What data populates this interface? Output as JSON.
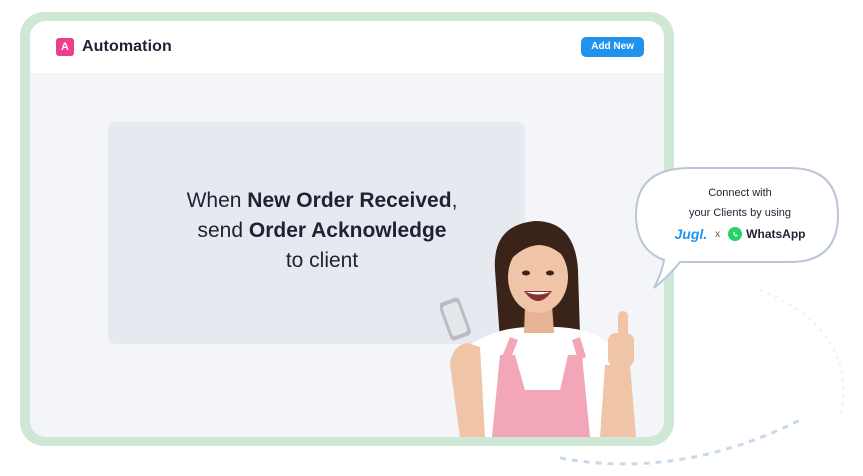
{
  "app": {
    "logo_letter": "A",
    "title": "Automation",
    "add_button_label": "Add New"
  },
  "rule": {
    "line1_prefix": "When ",
    "trigger": "New Order Received",
    "line1_suffix": ",",
    "line2_prefix": "send ",
    "action": "Order Acknowledge",
    "line3": "to client"
  },
  "bubble": {
    "line1": "Connect with",
    "line2": "your Clients by using",
    "jugl_logo": "Jugl.",
    "separator": "x",
    "whatsapp_label": "WhatsApp"
  },
  "colors": {
    "accent": "#1f93ee",
    "logo_pink": "#ee3f8c",
    "frame_green": "#cfe8d6",
    "whatsapp_green": "#25d366"
  },
  "icons": {
    "brand_logo": "letter-a-square",
    "whatsapp": "whatsapp-icon"
  }
}
